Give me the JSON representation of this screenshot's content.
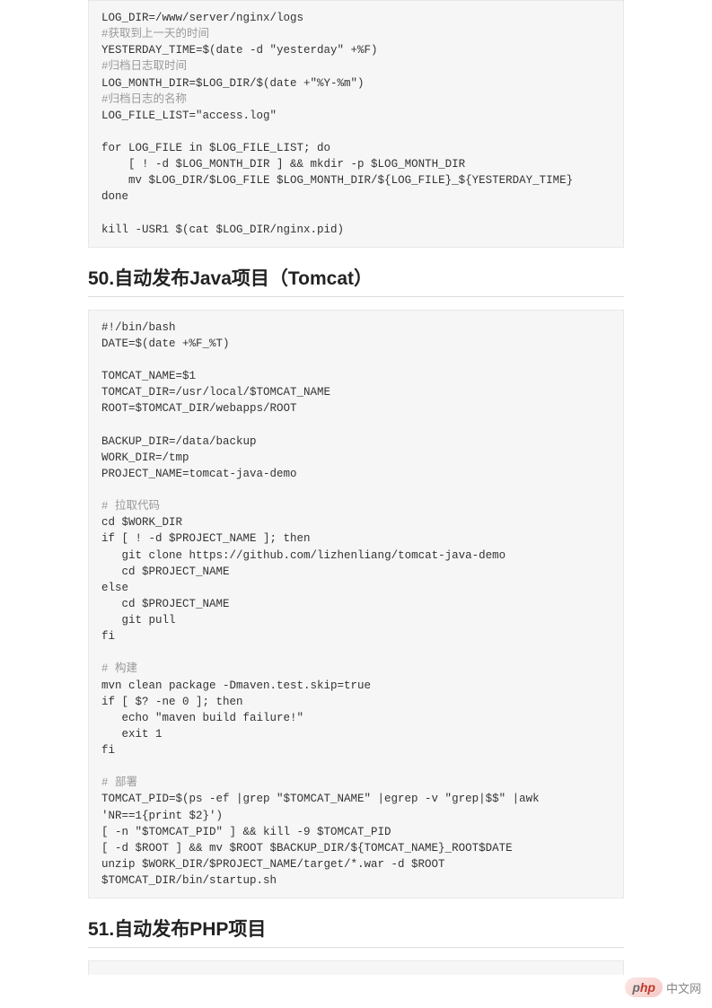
{
  "code1_lines": [
    {
      "t": "LOG_DIR=/www/server/nginx/logs",
      "c": false
    },
    {
      "t": "#获取到上一天的时间",
      "c": true
    },
    {
      "t": "YESTERDAY_TIME=$(date -d \"yesterday\" +%F)",
      "c": false
    },
    {
      "t": "#归档日志取时间",
      "c": true
    },
    {
      "t": "LOG_MONTH_DIR=$LOG_DIR/$(date +\"%Y-%m\")",
      "c": false
    },
    {
      "t": "#归档日志的名称",
      "c": true
    },
    {
      "t": "LOG_FILE_LIST=\"access.log\"",
      "c": false
    },
    {
      "t": "",
      "c": false
    },
    {
      "t": "for LOG_FILE in $LOG_FILE_LIST; do",
      "c": false
    },
    {
      "t": "    [ ! -d $LOG_MONTH_DIR ] && mkdir -p $LOG_MONTH_DIR",
      "c": false
    },
    {
      "t": "    mv $LOG_DIR/$LOG_FILE $LOG_MONTH_DIR/${LOG_FILE}_${YESTERDAY_TIME}",
      "c": false
    },
    {
      "t": "done",
      "c": false
    },
    {
      "t": "",
      "c": false
    },
    {
      "t": "kill -USR1 $(cat $LOG_DIR/nginx.pid)",
      "c": false
    }
  ],
  "heading50": "50.自动发布Java项目（Tomcat）",
  "code2_lines": [
    {
      "t": "#!/bin/bash",
      "c": false
    },
    {
      "t": "DATE=$(date +%F_%T)",
      "c": false
    },
    {
      "t": "",
      "c": false
    },
    {
      "t": "TOMCAT_NAME=$1",
      "c": false
    },
    {
      "t": "TOMCAT_DIR=/usr/local/$TOMCAT_NAME",
      "c": false
    },
    {
      "t": "ROOT=$TOMCAT_DIR/webapps/ROOT",
      "c": false
    },
    {
      "t": "",
      "c": false
    },
    {
      "t": "BACKUP_DIR=/data/backup",
      "c": false
    },
    {
      "t": "WORK_DIR=/tmp",
      "c": false
    },
    {
      "t": "PROJECT_NAME=tomcat-java-demo",
      "c": false
    },
    {
      "t": "",
      "c": false
    },
    {
      "t": "# 拉取代码",
      "c": true
    },
    {
      "t": "cd $WORK_DIR",
      "c": false
    },
    {
      "t": "if [ ! -d $PROJECT_NAME ]; then",
      "c": false
    },
    {
      "t": "   git clone https://github.com/lizhenliang/tomcat-java-demo",
      "c": false
    },
    {
      "t": "   cd $PROJECT_NAME",
      "c": false
    },
    {
      "t": "else",
      "c": false
    },
    {
      "t": "   cd $PROJECT_NAME",
      "c": false
    },
    {
      "t": "   git pull",
      "c": false
    },
    {
      "t": "fi",
      "c": false
    },
    {
      "t": "",
      "c": false
    },
    {
      "t": "# 构建",
      "c": true
    },
    {
      "t": "mvn clean package -Dmaven.test.skip=true",
      "c": false
    },
    {
      "t": "if [ $? -ne 0 ]; then",
      "c": false
    },
    {
      "t": "   echo \"maven build failure!\"",
      "c": false
    },
    {
      "t": "   exit 1",
      "c": false
    },
    {
      "t": "fi",
      "c": false
    },
    {
      "t": "",
      "c": false
    },
    {
      "t": "# 部署",
      "c": true
    },
    {
      "t": "TOMCAT_PID=$(ps -ef |grep \"$TOMCAT_NAME\" |egrep -v \"grep|$$\" |awk 'NR==1{print $2}')",
      "c": false
    },
    {
      "t": "[ -n \"$TOMCAT_PID\" ] && kill -9 $TOMCAT_PID",
      "c": false
    },
    {
      "t": "[ -d $ROOT ] && mv $ROOT $BACKUP_DIR/${TOMCAT_NAME}_ROOT$DATE",
      "c": false
    },
    {
      "t": "unzip $WORK_DIR/$PROJECT_NAME/target/*.war -d $ROOT",
      "c": false
    },
    {
      "t": "$TOMCAT_DIR/bin/startup.sh",
      "c": false
    }
  ],
  "heading51": "51.自动发布PHP项目",
  "watermark": {
    "badge_p": "p",
    "badge_hp": "hp",
    "text": "中文网"
  }
}
